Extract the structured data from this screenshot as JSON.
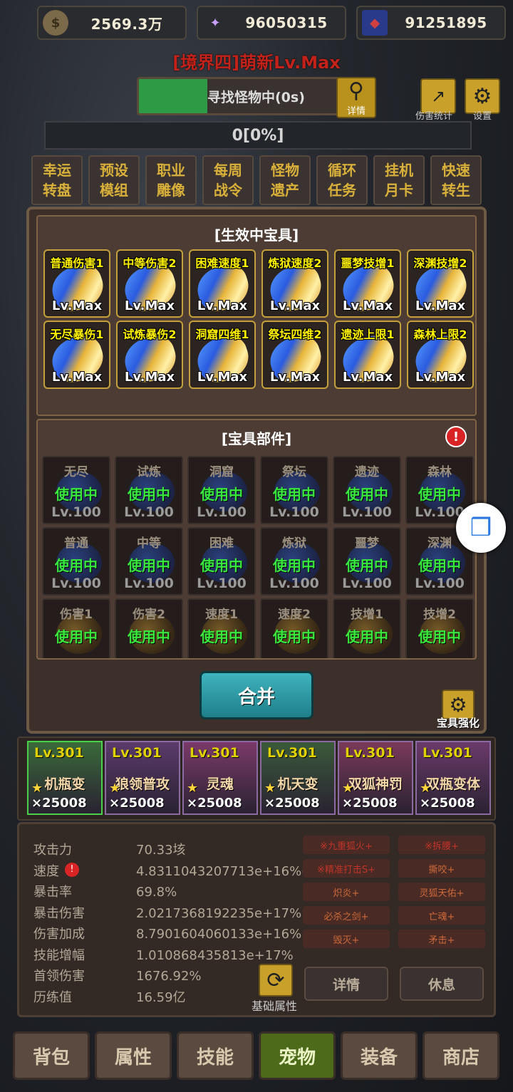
{
  "currency": [
    {
      "icon": "gold-coin-icon",
      "value": "2569.3万"
    },
    {
      "icon": "crystal-icon",
      "value": "96050315"
    },
    {
      "icon": "card-icon",
      "value": "91251895"
    }
  ],
  "header": {
    "title": "[境界四]萌新Lv.Max",
    "status": "寻找怪物中(0s)",
    "detail_label": "详情",
    "damage_stats_label": "伤害统计",
    "settings_label": "设置",
    "hp_text": "0[0%]"
  },
  "menu": [
    {
      "line1": "幸运",
      "line2": "转盘"
    },
    {
      "line1": "预设",
      "line2": "模组"
    },
    {
      "line1": "职业",
      "line2": "雕像"
    },
    {
      "line1": "每周",
      "line2": "战令"
    },
    {
      "line1": "怪物",
      "line2": "遗产"
    },
    {
      "line1": "循环",
      "line2": "任务"
    },
    {
      "line1": "挂机",
      "line2": "月卡"
    },
    {
      "line1": "快速",
      "line2": "转生"
    }
  ],
  "active": {
    "title": "[生效中宝具]",
    "items": [
      {
        "name": "普通伤害1",
        "lv": "Lv.Max"
      },
      {
        "name": "中等伤害2",
        "lv": "Lv.Max"
      },
      {
        "name": "困难速度1",
        "lv": "Lv.Max"
      },
      {
        "name": "炼狱速度2",
        "lv": "Lv.Max"
      },
      {
        "name": "噩梦技增1",
        "lv": "Lv.Max"
      },
      {
        "name": "深渊技增2",
        "lv": "Lv.Max"
      },
      {
        "name": "无尽暴伤1",
        "lv": "Lv.Max"
      },
      {
        "name": "试炼暴伤2",
        "lv": "Lv.Max"
      },
      {
        "name": "洞窟四维1",
        "lv": "Lv.Max"
      },
      {
        "name": "祭坛四维2",
        "lv": "Lv.Max"
      },
      {
        "name": "遗迹上限1",
        "lv": "Lv.Max"
      },
      {
        "name": "森林上限2",
        "lv": "Lv.Max"
      }
    ]
  },
  "parts": {
    "title": "[宝具部件]",
    "alert": "!",
    "items": [
      {
        "name": "无尽",
        "status": "使用中",
        "lv": "Lv.100"
      },
      {
        "name": "试炼",
        "status": "使用中",
        "lv": "Lv.100"
      },
      {
        "name": "洞窟",
        "status": "使用中",
        "lv": "Lv.100"
      },
      {
        "name": "祭坛",
        "status": "使用中",
        "lv": "Lv.100"
      },
      {
        "name": "遗迹",
        "status": "使用中",
        "lv": "Lv.100"
      },
      {
        "name": "森林",
        "status": "使用中",
        "lv": "Lv.100"
      },
      {
        "name": "普通",
        "status": "使用中",
        "lv": "Lv.100"
      },
      {
        "name": "中等",
        "status": "使用中",
        "lv": "Lv.100"
      },
      {
        "name": "困难",
        "status": "使用中",
        "lv": "Lv.100"
      },
      {
        "name": "炼狱",
        "status": "使用中",
        "lv": "Lv.100"
      },
      {
        "name": "噩梦",
        "status": "使用中",
        "lv": "Lv.100"
      },
      {
        "name": "深渊",
        "status": "使用中",
        "lv": "Lv.100"
      },
      {
        "name": "伤害1",
        "status": "使用中",
        "lv": ""
      },
      {
        "name": "伤害2",
        "status": "使用中",
        "lv": ""
      },
      {
        "name": "速度1",
        "status": "使用中",
        "lv": ""
      },
      {
        "name": "速度2",
        "status": "使用中",
        "lv": ""
      },
      {
        "name": "技增1",
        "status": "使用中",
        "lv": ""
      },
      {
        "name": "技增2",
        "status": "使用中",
        "lv": ""
      }
    ]
  },
  "merge_label": "合并",
  "enhance_label": "宝具强化",
  "pets": [
    {
      "lv": "Lv.301",
      "name": "机瓶变",
      "stars": "×25008"
    },
    {
      "lv": "Lv.301",
      "name": "狼领普攻",
      "stars": "×25008"
    },
    {
      "lv": "Lv.301",
      "name": "灵魂",
      "stars": "×25008"
    },
    {
      "lv": "Lv.301",
      "name": "机天变",
      "stars": "×25008"
    },
    {
      "lv": "Lv.301",
      "name": "双狐神罚",
      "stars": "×25008"
    },
    {
      "lv": "Lv.301",
      "name": "双瓶变体",
      "stars": "×25008"
    }
  ],
  "stats": [
    {
      "k": "攻击力",
      "v": "70.33垓"
    },
    {
      "k": "速度",
      "v": "4.8311043207713e+16%("
    },
    {
      "k": "暴击率",
      "v": "69.8%"
    },
    {
      "k": "暴击伤害",
      "v": "2.0217368192235e+17%"
    },
    {
      "k": "伤害加成",
      "v": "8.7901604060133e+16%"
    },
    {
      "k": "技能增幅",
      "v": "1.010868435813e+17%"
    },
    {
      "k": "首领伤害",
      "v": "1676.92%"
    },
    {
      "k": "历练值",
      "v": "16.59亿"
    }
  ],
  "tags": [
    "※九重狐火+",
    "※拆腰+",
    "※精准打击S+",
    "撕咬+",
    "炽炎+",
    "灵狐天佑+",
    "必杀之剑+",
    "亡魂+",
    "毁灭+",
    "矛击+"
  ],
  "base_attr_label": "基础属性",
  "details_label": "详情",
  "rest_label": "休息",
  "nav": [
    "背包",
    "属性",
    "技能",
    "宠物",
    "装备",
    "商店"
  ]
}
